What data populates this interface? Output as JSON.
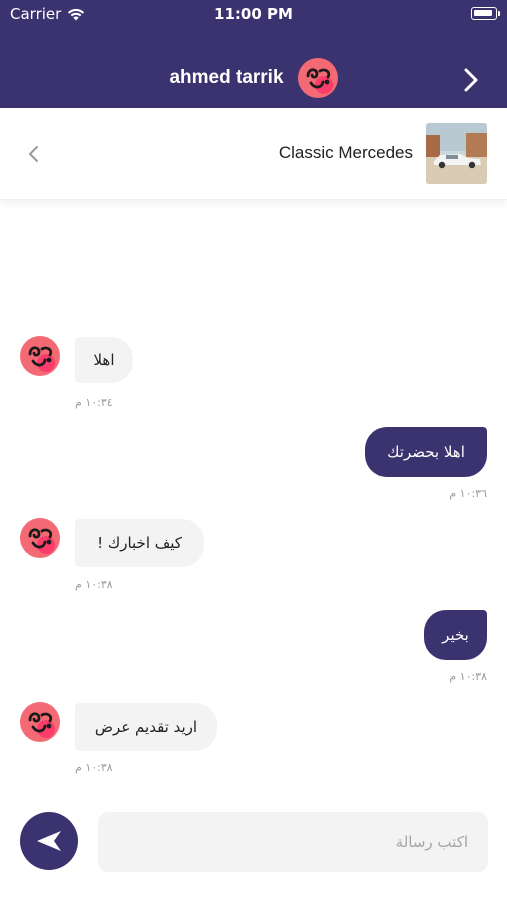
{
  "status_bar": {
    "carrier": "Carrier",
    "time": "11:00 PM"
  },
  "header": {
    "title": "ahmed tarrik",
    "back_icon": "chevron-right-icon",
    "avatar_icon": "emoji-avatar-icon"
  },
  "product": {
    "name": "Classic Mercedes",
    "chevron_icon": "chevron-left-icon",
    "image": "classic-car-thumbnail"
  },
  "messages": [
    {
      "direction": "incoming",
      "text": "اهلا",
      "time": "١٠:٣٤ م"
    },
    {
      "direction": "outgoing",
      "text": "اهلا بحضرتك",
      "time": "١٠:٣٦ م"
    },
    {
      "direction": "incoming",
      "text": "كيف اخبارك !",
      "time": "١٠:٣٨ م"
    },
    {
      "direction": "outgoing",
      "text": "بخير",
      "time": "١٠:٣٨ م"
    },
    {
      "direction": "incoming",
      "text": "اريد تقديم عرض",
      "time": "١٠:٣٨ م"
    }
  ],
  "composer": {
    "placeholder": "اكتب رسالة",
    "value": ""
  },
  "colors": {
    "primary": "#3b336f",
    "bubble_incoming": "#f3f3f3",
    "avatar": "#f46a74"
  }
}
